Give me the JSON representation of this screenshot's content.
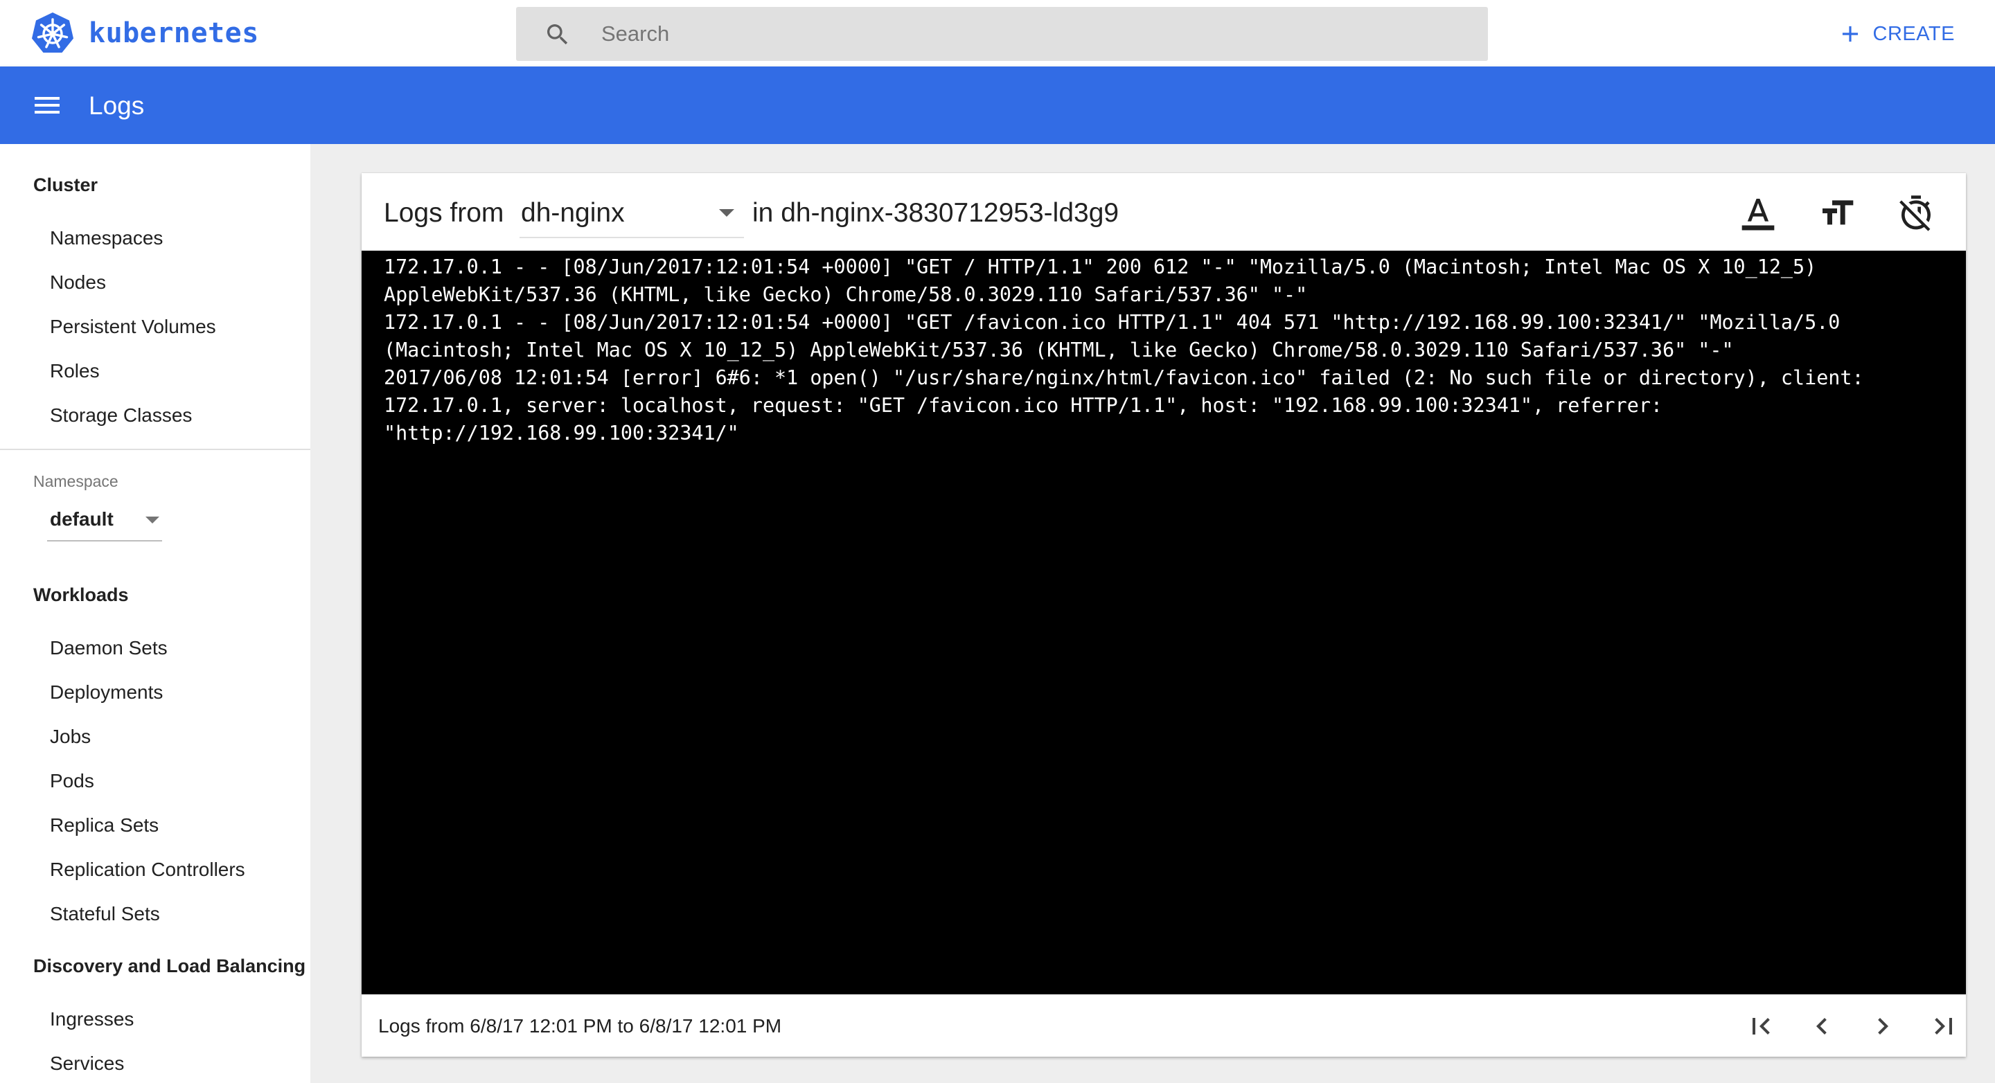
{
  "header": {
    "brand": "kubernetes",
    "brand_icon": "kubernetes-helm-icon",
    "search_placeholder": "Search",
    "create_label": "CREATE",
    "brand_color": "#326ce5"
  },
  "toolbar": {
    "title": "Logs",
    "menu_icon": "hamburger-menu-icon",
    "color": "#326ce5"
  },
  "sidebar": {
    "cluster": {
      "title": "Cluster",
      "items": [
        "Namespaces",
        "Nodes",
        "Persistent Volumes",
        "Roles",
        "Storage Classes"
      ]
    },
    "namespace": {
      "label": "Namespace",
      "value": "default"
    },
    "workloads": {
      "title": "Workloads",
      "items": [
        "Daemon Sets",
        "Deployments",
        "Jobs",
        "Pods",
        "Replica Sets",
        "Replication Controllers",
        "Stateful Sets"
      ]
    },
    "discovery": {
      "title": "Discovery and Load Balancing",
      "items": [
        "Ingresses",
        "Services"
      ]
    }
  },
  "logs": {
    "logs_from_label": "Logs from",
    "container": "dh-nginx",
    "pod_label": "in dh-nginx-3830712953-ld3g9",
    "actions": [
      "text-color-icon",
      "text-size-icon",
      "timestamp-toggle-icon"
    ],
    "lines": [
      "172.17.0.1 - - [08/Jun/2017:12:01:54 +0000] \"GET / HTTP/1.1\" 200 612 \"-\" \"Mozilla/5.0 (Macintosh; Intel Mac OS X 10_12_5) AppleWebKit/537.36 (KHTML, like Gecko) Chrome/58.0.3029.110 Safari/537.36\" \"-\"",
      "172.17.0.1 - - [08/Jun/2017:12:01:54 +0000] \"GET /favicon.ico HTTP/1.1\" 404 571 \"http://192.168.99.100:32341/\" \"Mozilla/5.0 (Macintosh; Intel Mac OS X 10_12_5) AppleWebKit/537.36 (KHTML, like Gecko) Chrome/58.0.3029.110 Safari/537.36\" \"-\"",
      "2017/06/08 12:01:54 [error] 6#6: *1 open() \"/usr/share/nginx/html/favicon.ico\" failed (2: No such file or directory), client: 172.17.0.1, server: localhost, request: \"GET /favicon.ico HTTP/1.1\", host: \"192.168.99.100:32341\", referrer: \"http://192.168.99.100:32341/\""
    ],
    "footer": "Logs from 6/8/17 12:01 PM to 6/8/17 12:01 PM",
    "pagination": [
      "first-page-icon",
      "previous-page-icon",
      "next-page-icon",
      "last-page-icon"
    ]
  }
}
